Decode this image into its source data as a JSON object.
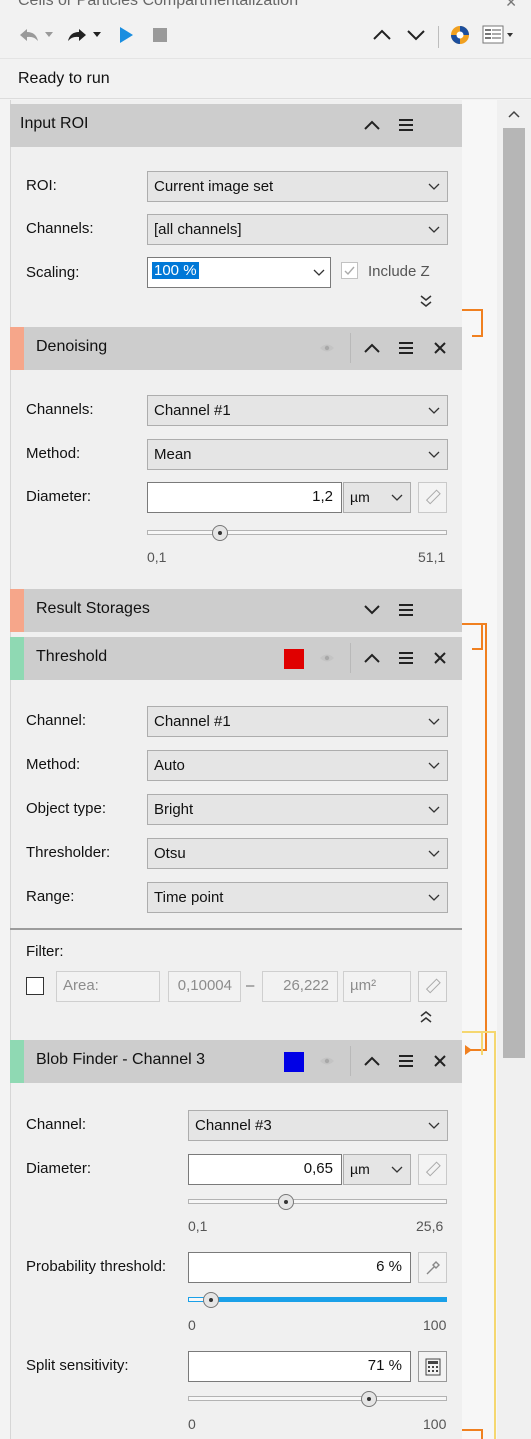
{
  "window": {
    "title": "Cells or Particles Compartmentalization"
  },
  "status": {
    "text": "Ready to run"
  },
  "colors": {
    "denoising": "#f6a68a",
    "result_storages": "#f6a68a",
    "threshold": "#8fd9b3",
    "blob_finder": "#8fd9b3",
    "threshold_swatch": "#e00000",
    "blob_swatch": "#0000e6",
    "connector_orange": "#f08020",
    "connector_yellow": "#f5d770",
    "accent": "#1aa0e8"
  },
  "input_roi": {
    "title": "Input ROI",
    "roi_label": "ROI:",
    "roi_value": "Current image set",
    "channels_label": "Channels:",
    "channels_value": "[all channels]",
    "scaling_label": "Scaling:",
    "scaling_value": "100 %",
    "include_z_label": "Include Z"
  },
  "denoising": {
    "title": "Denoising",
    "channels_label": "Channels:",
    "channels_value": "Channel #1",
    "method_label": "Method:",
    "method_value": "Mean",
    "diameter_label": "Diameter:",
    "diameter_value": "1,2",
    "diameter_unit": "µm",
    "slider_min": "0,1",
    "slider_max": "51,1",
    "slider_value": 0.23
  },
  "result_storages": {
    "title": "Result Storages"
  },
  "threshold": {
    "title": "Threshold",
    "channel_label": "Channel:",
    "channel_value": "Channel #1",
    "method_label": "Method:",
    "method_value": "Auto",
    "object_type_label": "Object type:",
    "object_type_value": "Bright",
    "thresholder_label": "Thresholder:",
    "thresholder_value": "Otsu",
    "range_label": "Range:",
    "range_value": "Time point",
    "filter_label": "Filter:",
    "filter_area_label": "Area:",
    "filter_min": "0,10004",
    "filter_dash": "–",
    "filter_max": "26,222",
    "filter_unit": "µm²"
  },
  "blob_finder": {
    "title": "Blob Finder - Channel 3",
    "channel_label": "Channel:",
    "channel_value": "Channel #3",
    "diameter_label": "Diameter:",
    "diameter_value": "0,65",
    "diameter_unit": "µm",
    "diameter_min": "0,1",
    "diameter_max": "25,6",
    "diameter_slider": 0.37,
    "prob_label": "Probability threshold:",
    "prob_value": "6 %",
    "prob_min": "0",
    "prob_max": "100",
    "prob_slider": 0.06,
    "split_label": "Split sensitivity:",
    "split_value": "71 %",
    "split_min": "0",
    "split_max": "100",
    "split_slider": 0.71
  }
}
